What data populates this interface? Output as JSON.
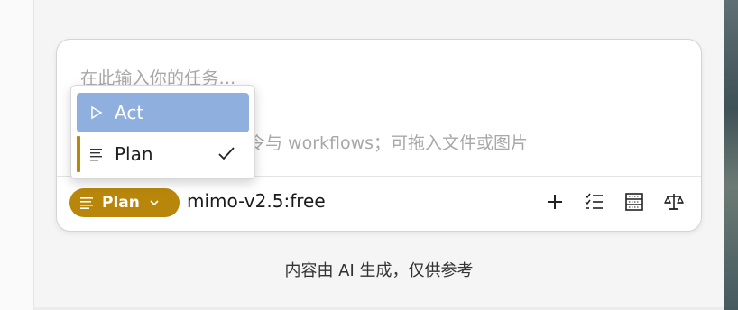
{
  "composer": {
    "placeholder": "在此输入你的任务...",
    "hint": "令与 workflows；可拖入文件或图片",
    "mode_label": "Plan",
    "model_name": "mimo-v2.5:free",
    "toolbar_icons": [
      "plus-icon",
      "checklist-icon",
      "server-icon",
      "scale-icon"
    ]
  },
  "mode_menu": {
    "items": [
      {
        "label": "Act",
        "icon": "play-icon",
        "highlighted": true,
        "selected": false
      },
      {
        "label": "Plan",
        "icon": "lines-icon",
        "highlighted": false,
        "selected": true
      }
    ]
  },
  "footer": {
    "disclaimer": "内容由 AI 生成，仅供参考"
  },
  "colors": {
    "accent": "#b8860b",
    "menu_highlight": "#8fb0df",
    "placeholder_text": "#a8a8a8"
  }
}
